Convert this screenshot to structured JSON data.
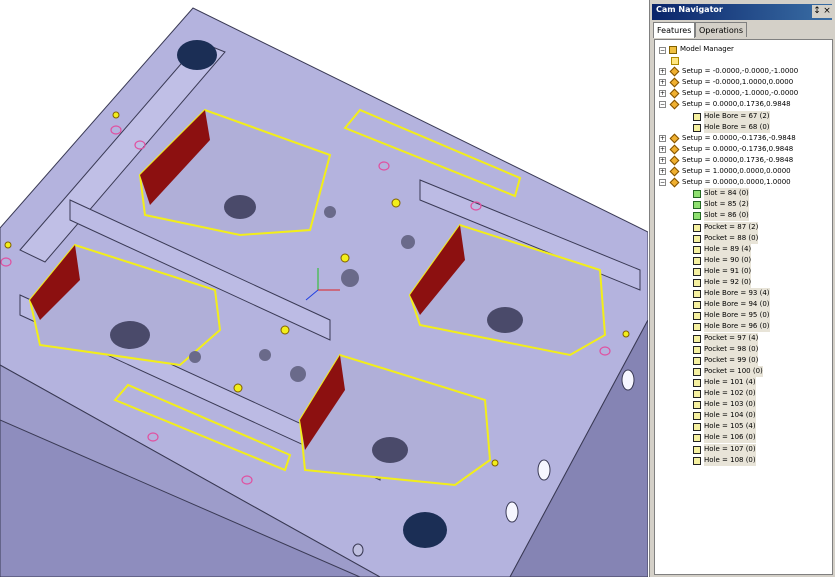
{
  "navigator": {
    "title": "Cam Navigator",
    "pin_glyph": "↕",
    "close_glyph": "×",
    "tabs": [
      {
        "label": "Features",
        "active": true
      },
      {
        "label": "Operations",
        "active": false
      }
    ],
    "tree": {
      "root": "Model Manager",
      "items": [
        {
          "label": "",
          "icon": "folder-icon",
          "depth": 1,
          "expander": ""
        },
        {
          "label": "Setup = -0.0000,-0.0000,-1.0000",
          "icon": "setup-icon",
          "depth": 1,
          "expander": "+"
        },
        {
          "label": "Setup = -0.0000,1.0000,0.0000",
          "icon": "setup-icon",
          "depth": 1,
          "expander": "+"
        },
        {
          "label": "Setup = -0.0000,-1.0000,-0.0000",
          "icon": "setup-icon",
          "depth": 1,
          "expander": "+"
        },
        {
          "label": "Setup = 0.0000,0.1736,0.9848",
          "icon": "setup-icon",
          "depth": 1,
          "expander": "-"
        },
        {
          "label": "Hole Bore = 67 (2)",
          "icon": "feature-icon",
          "depth": 2,
          "expander": ""
        },
        {
          "label": "Hole Bore = 68 (0)",
          "icon": "feature-icon",
          "depth": 2,
          "expander": ""
        },
        {
          "label": "Setup = 0.0000,-0.1736,-0.9848",
          "icon": "setup-icon",
          "depth": 1,
          "expander": "+"
        },
        {
          "label": "Setup = 0.0000,-0.1736,0.9848",
          "icon": "setup-icon",
          "depth": 1,
          "expander": "+"
        },
        {
          "label": "Setup = 0.0000,0.1736,-0.9848",
          "icon": "setup-icon",
          "depth": 1,
          "expander": "+"
        },
        {
          "label": "Setup = 1.0000,0.0000,0.0000",
          "icon": "setup-icon",
          "depth": 1,
          "expander": "+"
        },
        {
          "label": "Setup = 0.0000,0.0000,1.0000",
          "icon": "setup-icon",
          "depth": 1,
          "expander": "-"
        },
        {
          "label": "Slot = 84 (0)",
          "icon": "slot-icon",
          "depth": 2,
          "expander": ""
        },
        {
          "label": "Slot = 85 (2)",
          "icon": "slot-icon",
          "depth": 2,
          "expander": ""
        },
        {
          "label": "Slot = 86 (0)",
          "icon": "slot-icon",
          "depth": 2,
          "expander": ""
        },
        {
          "label": "Pocket = 87 (2)",
          "icon": "feature-icon",
          "depth": 2,
          "expander": ""
        },
        {
          "label": "Pocket = 88 (0)",
          "icon": "feature-icon",
          "depth": 2,
          "expander": ""
        },
        {
          "label": "Hole = 89 (4)",
          "icon": "feature-icon",
          "depth": 2,
          "expander": ""
        },
        {
          "label": "Hole = 90 (0)",
          "icon": "feature-icon",
          "depth": 2,
          "expander": ""
        },
        {
          "label": "Hole = 91 (0)",
          "icon": "feature-icon",
          "depth": 2,
          "expander": ""
        },
        {
          "label": "Hole = 92 (0)",
          "icon": "feature-icon",
          "depth": 2,
          "expander": ""
        },
        {
          "label": "Hole Bore = 93 (4)",
          "icon": "feature-icon",
          "depth": 2,
          "expander": ""
        },
        {
          "label": "Hole Bore = 94 (0)",
          "icon": "feature-icon",
          "depth": 2,
          "expander": ""
        },
        {
          "label": "Hole Bore = 95 (0)",
          "icon": "feature-icon",
          "depth": 2,
          "expander": ""
        },
        {
          "label": "Hole Bore = 96 (0)",
          "icon": "feature-icon",
          "depth": 2,
          "expander": ""
        },
        {
          "label": "Pocket = 97 (4)",
          "icon": "feature-icon",
          "depth": 2,
          "expander": ""
        },
        {
          "label": "Pocket = 98 (0)",
          "icon": "feature-icon",
          "depth": 2,
          "expander": ""
        },
        {
          "label": "Pocket = 99 (0)",
          "icon": "feature-icon",
          "depth": 2,
          "expander": ""
        },
        {
          "label": "Pocket = 100 (0)",
          "icon": "feature-icon",
          "depth": 2,
          "expander": ""
        },
        {
          "label": "Hole = 101 (4)",
          "icon": "feature-icon",
          "depth": 2,
          "expander": ""
        },
        {
          "label": "Hole = 102 (0)",
          "icon": "feature-icon",
          "depth": 2,
          "expander": ""
        },
        {
          "label": "Hole = 103 (0)",
          "icon": "feature-icon",
          "depth": 2,
          "expander": ""
        },
        {
          "label": "Hole = 104 (0)",
          "icon": "feature-icon",
          "depth": 2,
          "expander": ""
        },
        {
          "label": "Hole = 105 (4)",
          "icon": "feature-icon",
          "depth": 2,
          "expander": ""
        },
        {
          "label": "Hole = 106 (0)",
          "icon": "feature-icon",
          "depth": 2,
          "expander": ""
        },
        {
          "label": "Hole = 107 (0)",
          "icon": "feature-icon",
          "depth": 2,
          "expander": ""
        },
        {
          "label": "Hole = 108 (0)",
          "icon": "feature-icon",
          "depth": 2,
          "expander": ""
        }
      ]
    }
  },
  "viewport": {
    "colors": {
      "part": "#a7a6d4",
      "part_top": "#b6b5de",
      "part_side": "#8887b8",
      "edge": "#3a3a55",
      "highlight": "#f2ee1a",
      "pocket_wall": "#8c1010",
      "hole_dark": "#1b2e55"
    }
  }
}
